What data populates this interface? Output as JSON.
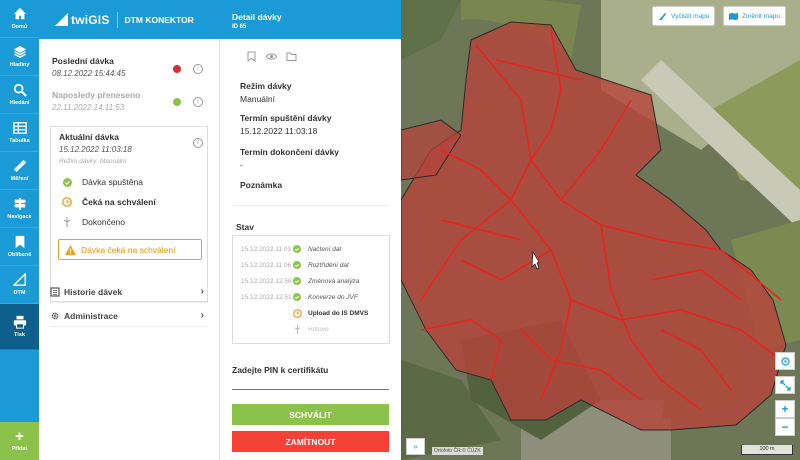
{
  "rail": {
    "items": [
      {
        "label": "Domů",
        "icon": "home-icon"
      },
      {
        "label": "Hladiny",
        "icon": "layers-icon"
      },
      {
        "label": "Hledání",
        "icon": "search-icon"
      },
      {
        "label": "Tabulka",
        "icon": "table-icon"
      },
      {
        "label": "Měření",
        "icon": "ruler-icon"
      },
      {
        "label": "Navigace",
        "icon": "signpost-icon"
      },
      {
        "label": "Oblíbené",
        "icon": "bookmark-icon"
      },
      {
        "label": "DTM",
        "icon": "dtm-icon"
      },
      {
        "label": "Tisk",
        "icon": "print-icon"
      }
    ],
    "add_label": "Přidat",
    "active": "Tisk"
  },
  "header": {
    "logo": "twiGIS",
    "product": "DTM KONEKTOR"
  },
  "left_panel": {
    "last_batch": {
      "title": "Poslední dávka",
      "date": "08.12.2022 15:44:45",
      "status_color": "#d32f2f"
    },
    "last_transferred": {
      "title": "Naposledy přeneseno",
      "date": "22.11.2022 14:11:53",
      "status_color": "#8bc34a"
    },
    "current": {
      "title": "Aktuální dávka",
      "date": "15.12.2022 11:03:18",
      "mode": "Režim dávky: Manuální",
      "steps": [
        {
          "label": "Dávka spuštěna",
          "state": "done"
        },
        {
          "label": "Čeká na schválení",
          "state": "waiting"
        },
        {
          "label": "Dokončeno",
          "state": "pending"
        }
      ],
      "warning": "Dávka čeká na schválení"
    },
    "menu": [
      {
        "label": "Historie dávek",
        "icon": "history-icon"
      },
      {
        "label": "Administrace",
        "icon": "gear-icon"
      }
    ]
  },
  "detail": {
    "title": "Detail dávky",
    "subtitle": "ID 65",
    "fields": [
      {
        "key": "Režim dávky",
        "value": "Manuální"
      },
      {
        "key": "Termín spuštění dávky",
        "value": "15.12.2022 11:03:18"
      },
      {
        "key": "Termín dokončení dávky",
        "value": "-"
      },
      {
        "key": "Poznámka",
        "value": ""
      }
    ],
    "stav_label": "Stav",
    "stav_rows": [
      {
        "time": "15.12.2022 11:03",
        "text": "Načtení dat",
        "state": "done"
      },
      {
        "time": "15.12.2022 11:06",
        "text": "Roztřídění dat",
        "state": "done"
      },
      {
        "time": "15.12.2022 12:58",
        "text": "Změnová analýza",
        "state": "done"
      },
      {
        "time": "15.12.2022 12:51",
        "text": "Konverze do JVF",
        "state": "done"
      },
      {
        "time": "",
        "text": "Upload do IS DMVS",
        "state": "waiting"
      },
      {
        "time": "",
        "text": "Hotovo",
        "state": "pending"
      }
    ],
    "pin_label": "Zadejte PIN k certifikátu",
    "approve": "SCHVÁLIT",
    "reject": "ZAMÍTNOUT",
    "close": "×"
  },
  "map": {
    "clear_map": "Vyčistit mapu",
    "change_map": "Změnit mapu",
    "attribution": "Ortofoto ČR © ČÚZK",
    "scale": "100 m",
    "expand": "»",
    "zoom_in": "+",
    "zoom_out": "−"
  },
  "colors": {
    "primary": "#1a9ad6",
    "primary_dark": "#0e5f8c",
    "green": "#8bc34a",
    "red": "#f44336",
    "orange": "#f0a020"
  }
}
